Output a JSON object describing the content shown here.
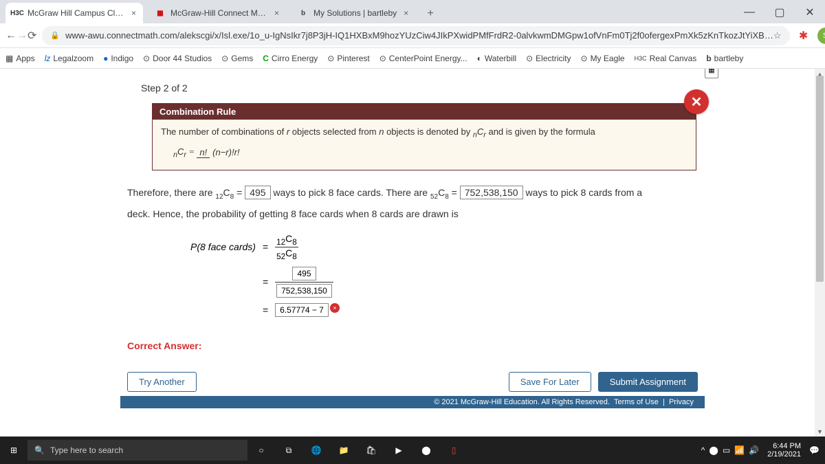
{
  "tabs": [
    {
      "favicon": "H3C",
      "color": "#333",
      "title": "McGraw Hill Campus Classic"
    },
    {
      "favicon": "▦",
      "color": "#c00",
      "title": "McGraw-Hill Connect Math"
    },
    {
      "favicon": "b",
      "color": "#000",
      "title": "My Solutions | bartleby"
    }
  ],
  "url": "www-awu.connectmath.com/alekscgi/x/Isl.exe/1o_u-IgNsIkr7j8P3jH-IQ1HXBxM9hozYUzCiw4JIkPXwidPMfFrdR2-0alvkwmDMGpw1ofVnFm0Tj2f0ofergexPmXk5zKnTkozJtYiXB…",
  "bookmarks": [
    {
      "icon": "▦",
      "label": "Apps"
    },
    {
      "icon": "lz",
      "label": "Legalzoom"
    },
    {
      "icon": "●",
      "label": "Indigo"
    },
    {
      "icon": "⊙",
      "label": "Door 44 Studios"
    },
    {
      "icon": "⊙",
      "label": "Gems"
    },
    {
      "icon": "C",
      "label": "Cirro Energy",
      "color": "#0a0"
    },
    {
      "icon": "⊙",
      "label": "Pinterest"
    },
    {
      "icon": "⊙",
      "label": "CenterPoint Energy..."
    },
    {
      "icon": "◐",
      "label": "Waterbill"
    },
    {
      "icon": "⊙",
      "label": "Electricity"
    },
    {
      "icon": "⊙",
      "label": "My Eagle"
    },
    {
      "icon": "H3C",
      "label": "Real Canvas"
    },
    {
      "icon": "b",
      "label": "bartleby"
    }
  ],
  "step_header": "Step 2 of 2",
  "rule": {
    "title": "Combination Rule",
    "body_before": "The number of combinations of ",
    "body_mid1": " objects selected from ",
    "body_mid2": " objects is denoted by ",
    "body_after": " and is given by the formula",
    "r": "r",
    "n": "n",
    "notation_pre": "n",
    "notation": "C",
    "notation_sub": "r",
    "formula_lhs_pre": "n",
    "formula_lhs": "C",
    "formula_lhs_sub": "r",
    "formula_num": "n!",
    "formula_den": "(n−r)!r!"
  },
  "therefore": {
    "text1": "Therefore, there are ",
    "c1_pre": "12",
    "c1": "C",
    "c1_sub": "8",
    "eq1": " = ",
    "val1": "495",
    "text2": " ways to pick 8 face cards. There are ",
    "c2_pre": "52",
    "c2": "C",
    "c2_sub": "8",
    "eq2": " = ",
    "val2": "752,538,150",
    "text3": " ways to pick 8 cards from a",
    "text4": "deck. Hence, the probability of getting 8 face cards when 8 cards are drawn is"
  },
  "calc": {
    "lhs": "P(8 face cards)",
    "frac_num_pre": "12",
    "frac_num": "C",
    "frac_num_sub": "8",
    "frac_den_pre": "52",
    "frac_den": "C",
    "frac_den_sub": "8",
    "num2": "495",
    "den2": "752,538,150",
    "ans": "6.57774 − 7"
  },
  "correct_label": "Correct Answer:",
  "buttons": {
    "try": "Try Another",
    "save": "Save For Later",
    "submit": "Submit Assignment"
  },
  "copyright": "© 2021 McGraw-Hill Education. All Rights Reserved.",
  "terms": "Terms of Use",
  "privacy": "Privacy",
  "taskbar": {
    "search_placeholder": "Type here to search",
    "time": "6:44 PM",
    "date": "2/19/2021"
  }
}
